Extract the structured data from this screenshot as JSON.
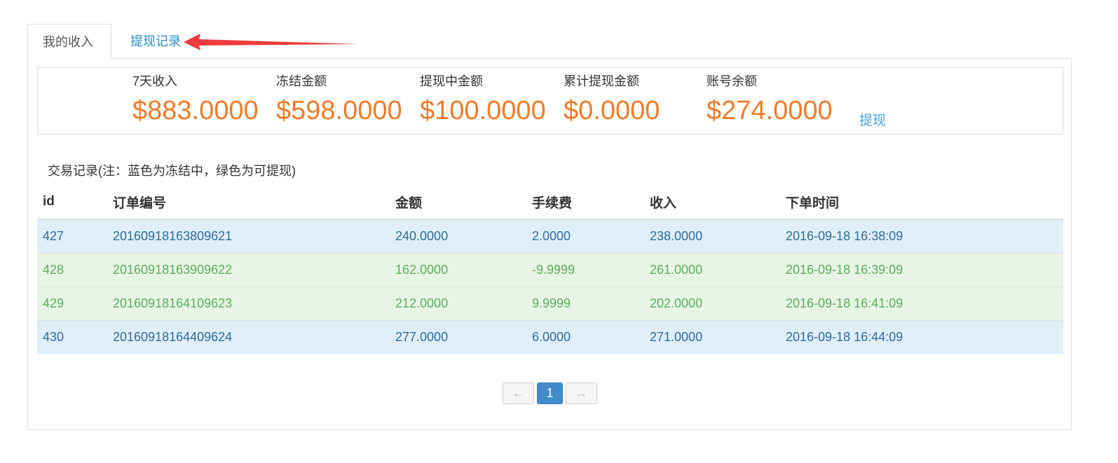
{
  "tabs": [
    {
      "label": "我的收入",
      "active": true
    },
    {
      "label": "提现记录",
      "active": false
    }
  ],
  "stats": [
    {
      "label": "7天收入",
      "value": "$883.0000"
    },
    {
      "label": "冻结金额",
      "value": "$598.0000"
    },
    {
      "label": "提现中金额",
      "value": "$100.0000"
    },
    {
      "label": "累计提现金额",
      "value": "$0.0000"
    },
    {
      "label": "账号余额",
      "value": "$274.0000"
    }
  ],
  "withdraw_label": "提现",
  "note": "交易记录(注：蓝色为冻结中，绿色为可提现)",
  "table": {
    "headers": [
      "id",
      "订单编号",
      "金额",
      "手续费",
      "收入",
      "下单时间"
    ],
    "rows": [
      {
        "status": "frozen",
        "cells": [
          "427",
          "20160918163809621",
          "240.0000",
          "2.0000",
          "238.0000",
          "2016-09-18 16:38:09"
        ]
      },
      {
        "status": "available",
        "cells": [
          "428",
          "20160918163909622",
          "162.0000",
          "-9.9999",
          "261.0000",
          "2016-09-18 16:39:09"
        ]
      },
      {
        "status": "available",
        "cells": [
          "429",
          "20160918164109623",
          "212.0000",
          "9.9999",
          "202.0000",
          "2016-09-18 16:41:09"
        ]
      },
      {
        "status": "frozen",
        "cells": [
          "430",
          "20160918164409624",
          "277.0000",
          "6.0000",
          "271.0000",
          "2016-09-18 16:44:09"
        ]
      }
    ]
  },
  "pagination": {
    "prev": "←",
    "current": "1",
    "next": "→"
  },
  "colors": {
    "accent_orange": "#f07c28",
    "link_blue": "#2a8ccc",
    "frozen_row": "#e0eef8",
    "available_row": "#e8f4e6",
    "annotation_arrow": "#f03c3c"
  }
}
